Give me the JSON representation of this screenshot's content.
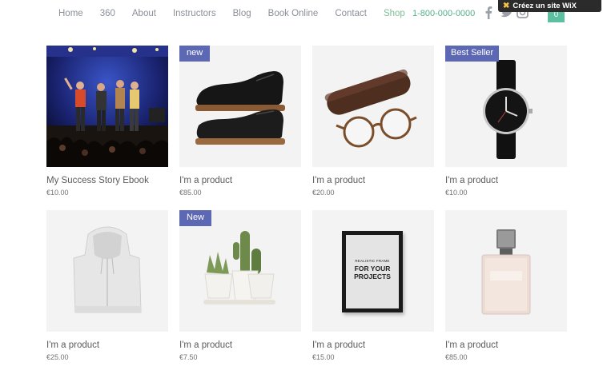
{
  "nav": {
    "items": [
      {
        "label": "Home"
      },
      {
        "label": "360"
      },
      {
        "label": "About"
      },
      {
        "label": "Instructors"
      },
      {
        "label": "Blog"
      },
      {
        "label": "Book Online"
      },
      {
        "label": "Contact"
      },
      {
        "label": "Shop",
        "active": true
      }
    ],
    "phone": "1-800-000-0000",
    "social_icons": [
      "facebook-icon",
      "twitter-icon",
      "instagram-icon"
    ],
    "cart_count": "0"
  },
  "wix_banner": {
    "label": "Créez un site WiX"
  },
  "products": [
    {
      "name": "My Success Story Ebook",
      "price": "€10.00",
      "badge": "",
      "image": "concert-photo"
    },
    {
      "name": "I'm a product",
      "price": "€85.00",
      "badge": "new",
      "image": "leather-shoe"
    },
    {
      "name": "I'm a product",
      "price": "€20.00",
      "badge": "",
      "image": "glasses-case"
    },
    {
      "name": "I'm a product",
      "price": "€10.00",
      "badge": "Best Seller",
      "image": "wrist-watch"
    },
    {
      "name": "I'm a product",
      "price": "€25.00",
      "badge": "",
      "image": "white-hoodie"
    },
    {
      "name": "I'm a product",
      "price": "€7.50",
      "badge": "New",
      "image": "cactus-pots"
    },
    {
      "name": "I'm a product",
      "price": "€15.00",
      "badge": "",
      "image": "picture-frame",
      "frame_text": [
        "REALISTIC FRAME",
        "FOR YOUR",
        "PROJECTS"
      ]
    },
    {
      "name": "I'm a product",
      "price": "€85.00",
      "badge": "",
      "image": "perfume-bottle"
    }
  ],
  "colors": {
    "accent": "#5cbfa0",
    "badge": "#5d68b5",
    "active_nav": "#7fbf97"
  }
}
